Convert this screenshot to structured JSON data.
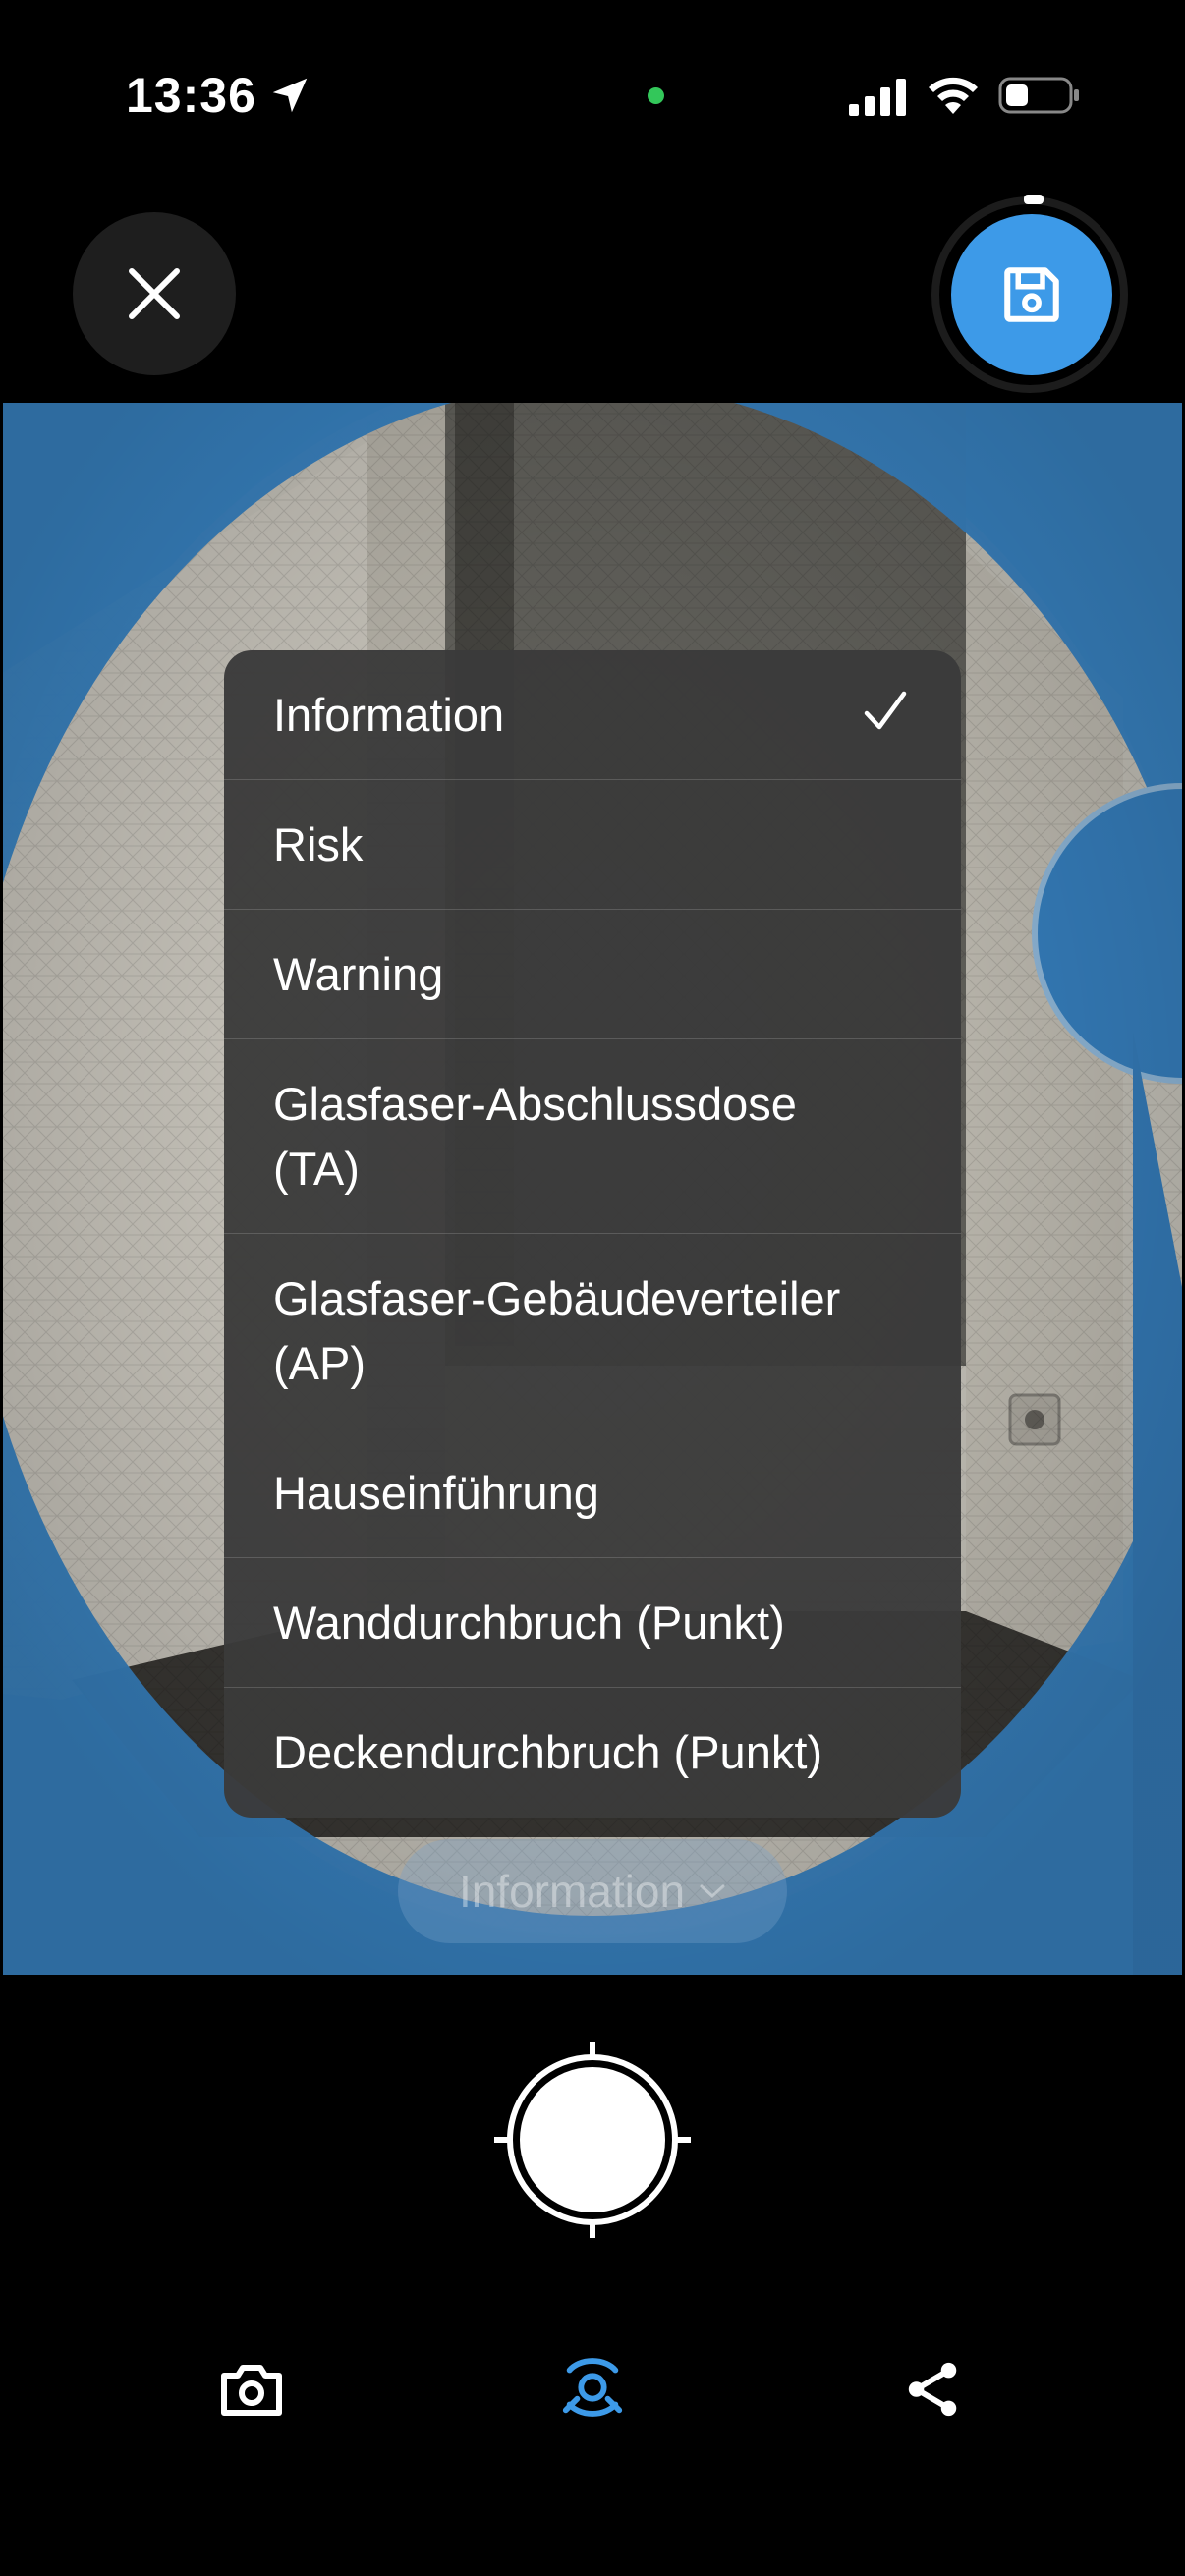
{
  "status_bar": {
    "time": "13:36"
  },
  "menu": {
    "items": [
      {
        "label": "Information",
        "selected": true
      },
      {
        "label": "Risk",
        "selected": false
      },
      {
        "label": "Warning",
        "selected": false
      },
      {
        "label": "Glasfaser-Abschlussdose (TA)",
        "selected": false
      },
      {
        "label": "Glasfaser-Gebäudeverteiler (AP)",
        "selected": false
      },
      {
        "label": "Hauseinführung",
        "selected": false
      },
      {
        "label": "Wanddurchbruch (Punkt)",
        "selected": false
      },
      {
        "label": "Deckendurchbruch (Punkt)",
        "selected": false
      }
    ]
  },
  "category_selector": {
    "label": "Information"
  },
  "colors": {
    "accent": "#3d9ae8",
    "overlay": "#3d8fd4"
  },
  "icons": {
    "close": "close-icon",
    "save": "save-icon",
    "camera": "camera-icon",
    "ar_scan": "ar-scan-icon",
    "share": "share-icon"
  }
}
